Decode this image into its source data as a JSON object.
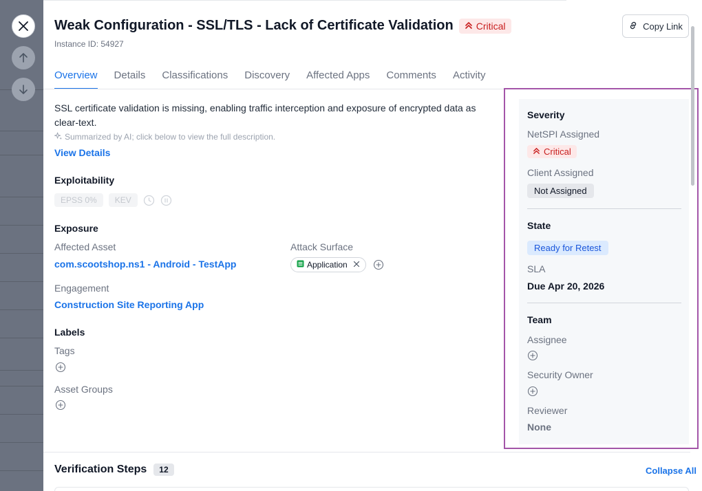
{
  "header": {
    "title": "Weak Configuration - SSL/TLS - Lack of Certificate Validation",
    "severity_badge": "Critical",
    "instance_id": "Instance ID: 54927",
    "copy_link": "Copy Link"
  },
  "tabs": [
    {
      "label": "Overview",
      "active": true
    },
    {
      "label": "Details"
    },
    {
      "label": "Classifications"
    },
    {
      "label": "Discovery"
    },
    {
      "label": "Affected Apps"
    },
    {
      "label": "Comments"
    },
    {
      "label": "Activity"
    }
  ],
  "overview": {
    "summary": "SSL certificate validation is missing, enabling traffic interception and exposure of encrypted data as clear-text.",
    "ai_note": "Summarized by AI; click below to view the full description.",
    "view_details": "View Details",
    "exploitability": {
      "heading": "Exploitability",
      "epss": "EPSS 0%",
      "kev": "KEV"
    },
    "exposure": {
      "heading": "Exposure",
      "affected_asset_label": "Affected Asset",
      "affected_asset_value": "com.scootshop.ns1 - Android - TestApp",
      "attack_surface_label": "Attack Surface",
      "attack_surface_chip": "Application",
      "engagement_label": "Engagement",
      "engagement_value": "Construction Site Reporting App"
    },
    "labels": {
      "heading": "Labels",
      "tags_label": "Tags",
      "asset_groups_label": "Asset Groups"
    }
  },
  "sidebar": {
    "severity_heading": "Severity",
    "netspi_label": "NetSPI Assigned",
    "netspi_value": "Critical",
    "client_label": "Client Assigned",
    "client_value": "Not Assigned",
    "state_heading": "State",
    "state_value": "Ready for Retest",
    "sla_label": "SLA",
    "sla_value": "Due Apr 20, 2026",
    "team_heading": "Team",
    "assignee_label": "Assignee",
    "security_owner_label": "Security Owner",
    "reviewer_label": "Reviewer",
    "reviewer_value": "None"
  },
  "verification": {
    "title": "Verification Steps",
    "count": "12",
    "collapse_all": "Collapse All"
  },
  "colors": {
    "accent": "#1a73e8",
    "critical": "#c81e1e",
    "highlight": "#a355a8"
  }
}
